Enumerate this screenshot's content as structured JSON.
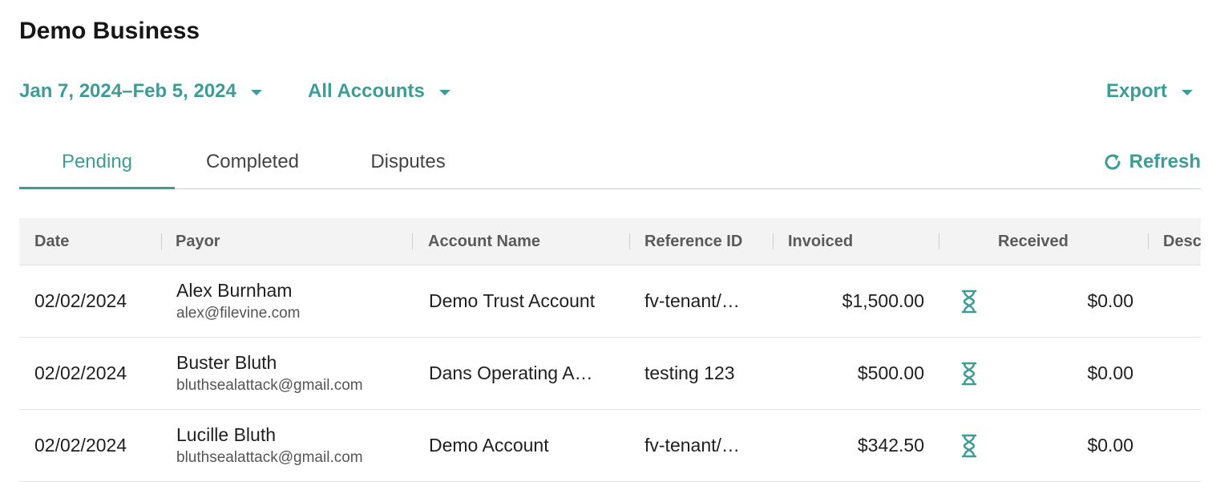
{
  "page": {
    "title": "Demo Business"
  },
  "filters": {
    "date_range": "Jan 7, 2024–Feb 5, 2024",
    "accounts": "All Accounts",
    "export": "Export"
  },
  "tabs": [
    {
      "label": "Pending",
      "active": true
    },
    {
      "label": "Completed",
      "active": false
    },
    {
      "label": "Disputes",
      "active": false
    }
  ],
  "refresh_label": "Refresh",
  "colors": {
    "accent": "#3d9c98",
    "header_bg": "#f3f3f3"
  },
  "table": {
    "columns": [
      "Date",
      "Payor",
      "Account Name",
      "Reference ID",
      "Invoiced",
      "Received",
      "Desc"
    ],
    "rows": [
      {
        "date": "02/02/2024",
        "payor_name": "Alex Burnham",
        "payor_email": "alex@filevine.com",
        "account": "Demo Trust Account",
        "reference": "fv-tenant/…",
        "invoiced": "$1,500.00",
        "status_icon": "hourglass-icon",
        "received": "$0.00"
      },
      {
        "date": "02/02/2024",
        "payor_name": "Buster Bluth",
        "payor_email": "bluthsealattack@gmail.com",
        "account": "Dans Operating A…",
        "reference": "testing 123",
        "invoiced": "$500.00",
        "status_icon": "hourglass-icon",
        "received": "$0.00"
      },
      {
        "date": "02/02/2024",
        "payor_name": "Lucille Bluth",
        "payor_email": "bluthsealattack@gmail.com",
        "account": "Demo Account",
        "reference": "fv-tenant/…",
        "invoiced": "$342.50",
        "status_icon": "hourglass-icon",
        "received": "$0.00"
      }
    ]
  }
}
